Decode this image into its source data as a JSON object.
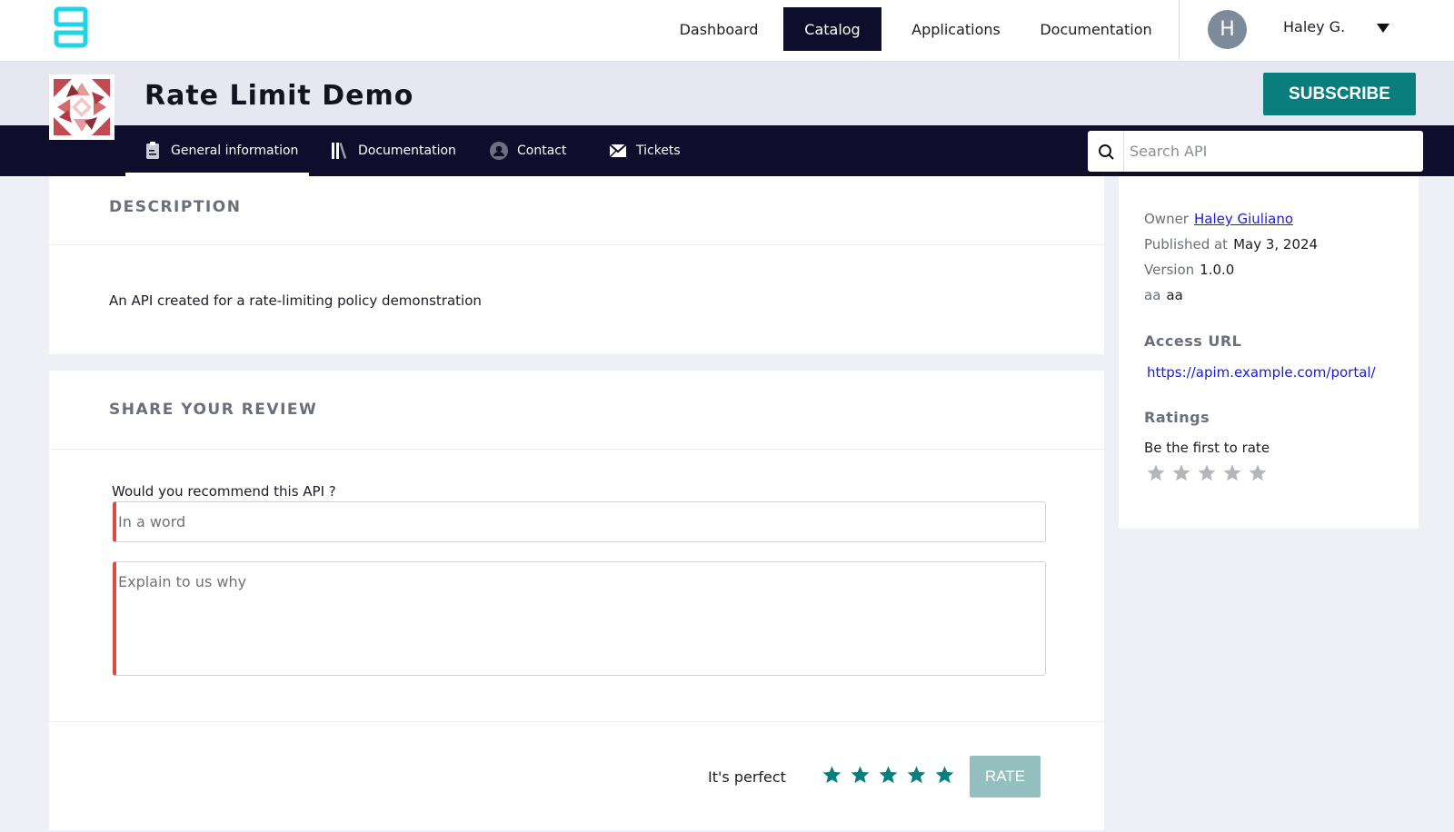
{
  "colors": {
    "brand_teal": "#0a7d7d",
    "nav_dark": "#0e0d2b",
    "error_red": "#e0493e",
    "link_blue": "#1a1adb",
    "rate_disabled": "#94bfbf"
  },
  "header": {
    "logo_icon": "gravitee-g-logo",
    "nav": [
      {
        "label": "Dashboard",
        "active": false
      },
      {
        "label": "Catalog",
        "active": true
      },
      {
        "label": "Applications",
        "active": false
      },
      {
        "label": "Documentation",
        "active": false
      }
    ],
    "user": {
      "avatar_initial": "H",
      "name": "Haley G.",
      "menu_icon": "caret-down-icon"
    }
  },
  "api": {
    "title": "Rate Limit Demo",
    "subscribe_label": "SUBSCRIBE"
  },
  "subnav": {
    "tabs": [
      {
        "label": "General information",
        "icon": "clipboard-icon",
        "active": true
      },
      {
        "label": "Documentation",
        "icon": "books-icon",
        "active": false
      },
      {
        "label": "Contact",
        "icon": "person-icon",
        "active": false
      },
      {
        "label": "Tickets",
        "icon": "envelope-icon",
        "active": false
      }
    ],
    "search_placeholder": "Search API"
  },
  "description": {
    "heading": "DESCRIPTION",
    "text": "An API created for a rate-limiting policy demonstration"
  },
  "review": {
    "heading": "SHARE YOUR REVIEW",
    "question": "Would you recommend this API ?",
    "word_placeholder": "In a word",
    "why_placeholder": "Explain to us why",
    "verdict": "It's perfect",
    "selected_stars": 5,
    "max_stars": 5,
    "rate_label": "RATE"
  },
  "sidebar": {
    "owner_label": "Owner",
    "owner_value": "Haley Giuliano",
    "published_label": "Published at",
    "published_value": "May 3, 2024",
    "version_label": "Version",
    "version_value": "1.0.0",
    "custom_label": "aa",
    "custom_value": "aa",
    "access_heading": "Access URL",
    "access_url": "https://apim.example.com/portal/",
    "ratings_heading": "Ratings",
    "ratings_text": "Be the first to rate",
    "rating_value": 0,
    "rating_max": 5
  }
}
